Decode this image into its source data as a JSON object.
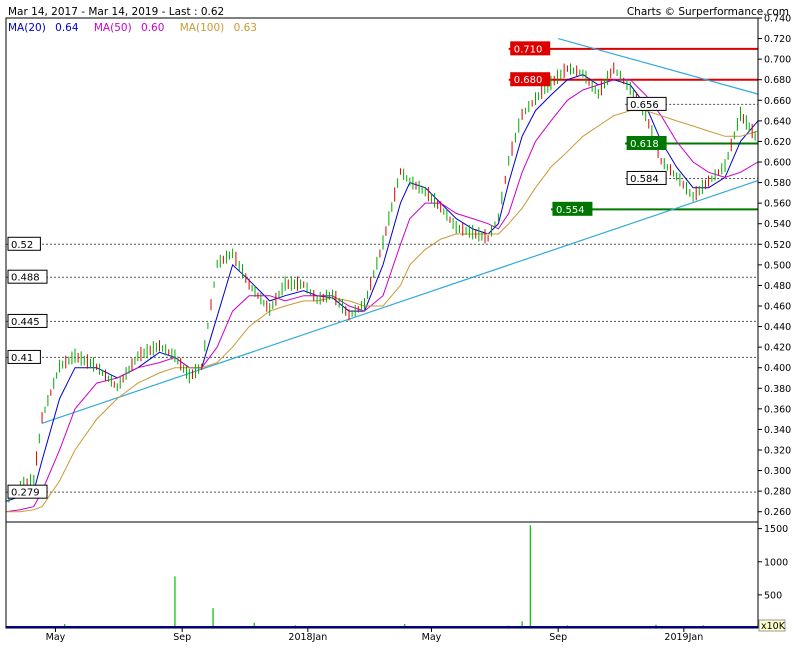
{
  "header": {
    "range_text": "Mar 14, 2017 - Mar 14, 2019 - Last : 0.62",
    "credit_text": "Charts © Surperformance.com"
  },
  "legend": [
    {
      "label": "MA(20)",
      "value": "0.64",
      "color": "#0000cc"
    },
    {
      "label": "MA(50)",
      "value": "0.60",
      "color": "#cc00cc"
    },
    {
      "label": "MA(100)",
      "value": "0.63",
      "color": "#cc9933"
    }
  ],
  "chart_data": {
    "type": "line",
    "title": "",
    "price_axis": {
      "ylim": [
        0.25,
        0.74
      ],
      "ticks": [
        "0.740",
        "0.720",
        "0.700",
        "0.680",
        "0.660",
        "0.640",
        "0.620",
        "0.600",
        "0.580",
        "0.560",
        "0.540",
        "0.520",
        "0.500",
        "0.480",
        "0.460",
        "0.440",
        "0.420",
        "0.400",
        "0.380",
        "0.360",
        "0.340",
        "0.320",
        "0.300",
        "0.280",
        "0.260"
      ]
    },
    "volume_axis": {
      "ylim": [
        0,
        1600
      ],
      "ticks": [
        "1500",
        "1000",
        "500"
      ],
      "unit_label": "x10K"
    },
    "x_axis": {
      "start": "2017-03-14",
      "end": "2019-03-14",
      "tick_labels": [
        "May",
        "Sep",
        "2018Jan",
        "May",
        "Sep",
        "2019Jan"
      ]
    },
    "price_series": {
      "dates": [
        "2017-03-14",
        "2017-03-28",
        "2017-04-10",
        "2017-04-18",
        "2017-05-05",
        "2017-05-20",
        "2017-06-10",
        "2017-06-30",
        "2017-07-20",
        "2017-08-10",
        "2017-08-25",
        "2017-09-08",
        "2017-09-20",
        "2017-10-05",
        "2017-10-20",
        "2017-11-05",
        "2017-11-25",
        "2017-12-10",
        "2017-12-28",
        "2018-01-10",
        "2018-01-25",
        "2018-02-10",
        "2018-02-25",
        "2018-03-15",
        "2018-04-01",
        "2018-04-10",
        "2018-04-25",
        "2018-05-10",
        "2018-05-25",
        "2018-06-10",
        "2018-06-25",
        "2018-07-05",
        "2018-07-15",
        "2018-07-28",
        "2018-08-10",
        "2018-08-25",
        "2018-09-10",
        "2018-09-25",
        "2018-10-10",
        "2018-10-25",
        "2018-11-10",
        "2018-11-25",
        "2018-12-10",
        "2018-12-25",
        "2019-01-10",
        "2019-01-25",
        "2019-02-10",
        "2019-02-25",
        "2019-03-14"
      ],
      "close": [
        0.27,
        0.285,
        0.29,
        0.35,
        0.4,
        0.41,
        0.4,
        0.38,
        0.41,
        0.42,
        0.41,
        0.39,
        0.4,
        0.5,
        0.51,
        0.48,
        0.455,
        0.48,
        0.48,
        0.465,
        0.47,
        0.45,
        0.46,
        0.52,
        0.59,
        0.58,
        0.57,
        0.555,
        0.535,
        0.53,
        0.525,
        0.545,
        0.6,
        0.645,
        0.66,
        0.675,
        0.69,
        0.685,
        0.665,
        0.69,
        0.67,
        0.645,
        0.6,
        0.585,
        0.565,
        0.58,
        0.595,
        0.645,
        0.62
      ]
    },
    "moving_averages": [
      {
        "name": "MA(20)",
        "color": "#0000cc",
        "values": [
          0.27,
          0.275,
          0.28,
          0.31,
          0.37,
          0.4,
          0.4,
          0.39,
          0.4,
          0.415,
          0.41,
          0.4,
          0.4,
          0.45,
          0.5,
          0.485,
          0.465,
          0.47,
          0.475,
          0.47,
          0.468,
          0.455,
          0.455,
          0.5,
          0.56,
          0.58,
          0.575,
          0.56,
          0.545,
          0.535,
          0.53,
          0.54,
          0.58,
          0.625,
          0.65,
          0.665,
          0.68,
          0.685,
          0.675,
          0.68,
          0.675,
          0.655,
          0.62,
          0.595,
          0.575,
          0.575,
          0.585,
          0.62,
          0.64
        ]
      },
      {
        "name": "MA(50)",
        "color": "#cc00cc",
        "values": [
          0.26,
          0.262,
          0.265,
          0.28,
          0.32,
          0.36,
          0.385,
          0.39,
          0.4,
          0.405,
          0.41,
          0.4,
          0.4,
          0.42,
          0.455,
          0.47,
          0.47,
          0.465,
          0.47,
          0.47,
          0.47,
          0.46,
          0.455,
          0.47,
          0.52,
          0.545,
          0.56,
          0.56,
          0.55,
          0.545,
          0.54,
          0.535,
          0.55,
          0.59,
          0.62,
          0.64,
          0.66,
          0.67,
          0.675,
          0.68,
          0.68,
          0.665,
          0.645,
          0.62,
          0.6,
          0.59,
          0.585,
          0.59,
          0.6
        ]
      },
      {
        "name": "MA(100)",
        "color": "#cc9933",
        "values": [
          0.26,
          0.26,
          0.262,
          0.265,
          0.29,
          0.32,
          0.35,
          0.37,
          0.385,
          0.395,
          0.4,
          0.4,
          0.4,
          0.405,
          0.42,
          0.44,
          0.455,
          0.46,
          0.465,
          0.465,
          0.468,
          0.465,
          0.46,
          0.46,
          0.48,
          0.5,
          0.515,
          0.525,
          0.53,
          0.53,
          0.53,
          0.53,
          0.54,
          0.555,
          0.575,
          0.595,
          0.61,
          0.625,
          0.635,
          0.645,
          0.65,
          0.65,
          0.645,
          0.64,
          0.635,
          0.63,
          0.625,
          0.625,
          0.63
        ]
      }
    ],
    "horizontal_levels": [
      {
        "label": "0.710",
        "value": 0.71,
        "style": "red-box",
        "from": "2018-07-15"
      },
      {
        "label": "0.680",
        "value": 0.68,
        "style": "red-box",
        "from": "2018-07-15"
      },
      {
        "label": "0.656",
        "value": 0.656,
        "style": "white-box-dotted",
        "from": "2018-11-05"
      },
      {
        "label": "0.618",
        "value": 0.618,
        "style": "green-box",
        "from": "2018-11-05"
      },
      {
        "label": "0.584",
        "value": 0.584,
        "style": "white-box-dotted",
        "from": "2018-11-05"
      },
      {
        "label": "0.554",
        "value": 0.554,
        "style": "green-box",
        "from": "2018-08-25"
      },
      {
        "label": "0.52",
        "value": 0.52,
        "style": "white-box-dotted",
        "from": "2017-03-14"
      },
      {
        "label": "0.488",
        "value": 0.488,
        "style": "white-box-dotted",
        "from": "2017-03-14"
      },
      {
        "label": "0.445",
        "value": 0.445,
        "style": "white-box-dotted",
        "from": "2017-03-14"
      },
      {
        "label": "0.41",
        "value": 0.41,
        "style": "white-box-dotted",
        "from": "2017-03-14"
      },
      {
        "label": "0.279",
        "value": 0.279,
        "style": "white-box-dotted",
        "from": "2017-03-14"
      }
    ],
    "trendlines": [
      {
        "from": [
          "2017-04-18",
          0.346
        ],
        "to": [
          "2019-03-14",
          0.582
        ],
        "color": "#33aadd"
      },
      {
        "from": [
          "2018-09-01",
          0.72
        ],
        "to": [
          "2019-03-14",
          0.666
        ],
        "color": "#33aadd"
      }
    ],
    "volume": {
      "dates": [
        "2017-03-20",
        "2017-04-15",
        "2017-05-10",
        "2017-06-15",
        "2017-07-20",
        "2017-08-10",
        "2017-08-25",
        "2017-09-05",
        "2017-10-01",
        "2017-11-10",
        "2017-12-20",
        "2018-02-10",
        "2018-04-05",
        "2018-06-01",
        "2018-07-15",
        "2018-07-28",
        "2018-08-05",
        "2018-09-10",
        "2018-10-20",
        "2018-12-05",
        "2019-01-20",
        "2019-02-25"
      ],
      "values": [
        20,
        30,
        60,
        25,
        20,
        30,
        780,
        25,
        300,
        80,
        40,
        30,
        60,
        25,
        35,
        100,
        1550,
        40,
        30,
        50,
        40,
        25
      ]
    }
  }
}
